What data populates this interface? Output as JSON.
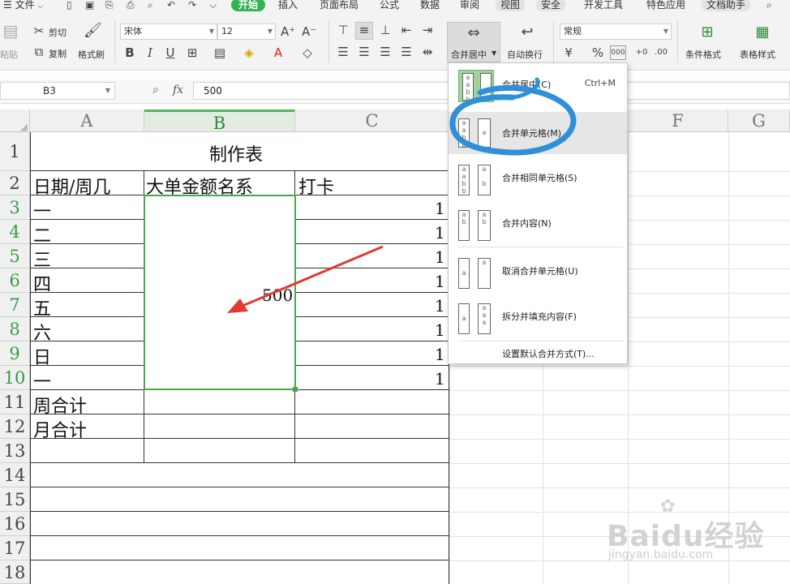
{
  "menu": {
    "file": "文件",
    "tabs": [
      "开始",
      "插入",
      "页面布局",
      "公式",
      "数据",
      "审阅",
      "视图",
      "安全",
      "开发工具",
      "特色应用",
      "文档助手"
    ]
  },
  "ribbon": {
    "paste": "粘贴",
    "cut": "剪切",
    "copy": "复制",
    "format_painter": "格式刷",
    "font_name": "宋体",
    "font_size": "12",
    "bold": "B",
    "italic": "I",
    "underline": "U",
    "merge_center": "合并居中",
    "wrap_text": "自动换行",
    "number_format": "常规",
    "percent": "%",
    "thousands": "000",
    "dec_inc": ".00",
    "cond_format": "条件格式",
    "table_style": "表格样式"
  },
  "formula_bar": {
    "name_box": "B3",
    "fx": "fx",
    "value": "500"
  },
  "columns": [
    "A",
    "B",
    "C",
    "F",
    "G"
  ],
  "rows": [
    "1",
    "2",
    "3",
    "4",
    "5",
    "6",
    "7",
    "8",
    "9",
    "10",
    "11",
    "12",
    "13",
    "14",
    "15",
    "16",
    "17",
    "18"
  ],
  "sheet": {
    "title": "制作表",
    "headers": {
      "a": "日期/周几",
      "b": "大单金额名系",
      "c": "打卡"
    },
    "col_a": [
      "一",
      "二",
      "三",
      "四",
      "五",
      "六",
      "日",
      "一",
      "周合计",
      "月合计"
    ],
    "col_c": [
      "1",
      "1",
      "1",
      "1",
      "1",
      "1",
      "1",
      "1"
    ],
    "merged_value": "500"
  },
  "dropdown": {
    "items": [
      {
        "label": "合并居中(C)",
        "shortcut": "Ctrl+M"
      },
      {
        "label": "合并单元格(M)"
      },
      {
        "label": "合并相同单元格(S)"
      },
      {
        "label": "合并内容(N)"
      },
      {
        "label": "取消合并单元格(U)"
      },
      {
        "label": "拆分并填充内容(F)"
      }
    ],
    "footer": "设置默认合并方式(T)..."
  },
  "watermark": {
    "text": "Baidu经验",
    "url": "jingyan.baidu.com"
  },
  "colors": {
    "accent_green": "#35b254",
    "selection": "#4ca64f",
    "annotation_blue": "#2f8fd8",
    "arrow_red": "#e03a32"
  }
}
